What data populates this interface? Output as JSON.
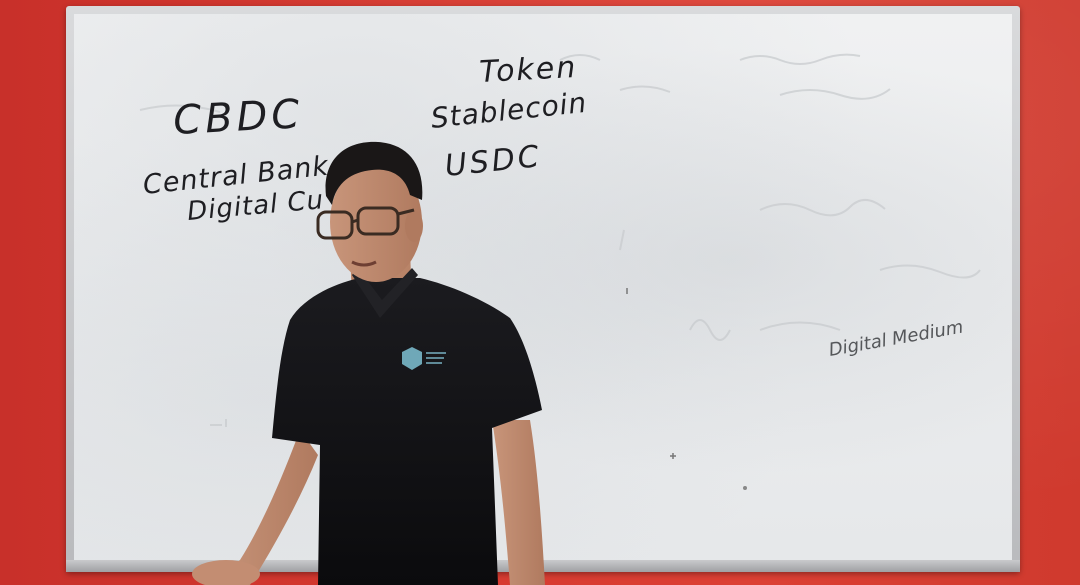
{
  "whiteboard": {
    "left_column": {
      "heading": "CBDC",
      "line1": "Central Bank",
      "line2": "Digital Cu"
    },
    "center_column": {
      "heading": "Token",
      "line1": "Stablecoin",
      "line2": "USDC"
    },
    "right_column": {
      "line1": "Digital Medium"
    }
  },
  "colors": {
    "wall": "#d63a30",
    "board": "#eceeef",
    "ink": "#1e1e22",
    "shirt": "#111114",
    "logo": "#6fa8b8"
  }
}
